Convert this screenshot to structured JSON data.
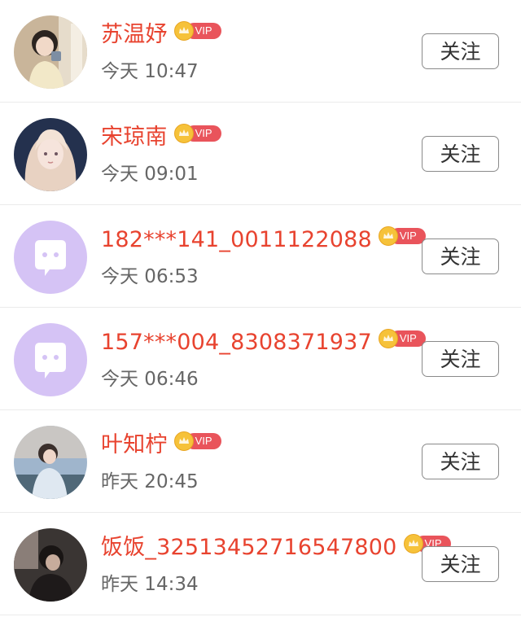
{
  "list": [
    {
      "name": "苏温妤",
      "badge": "VIP",
      "time": "今天 10:47",
      "follow_label": "关注",
      "avatar": "photo"
    },
    {
      "name": "宋琼南",
      "badge": "VIP",
      "time": "今天 09:01",
      "follow_label": "关注",
      "avatar": "photo"
    },
    {
      "name": "182***141_0011122088",
      "badge": "VIP",
      "time": "今天 06:53",
      "follow_label": "关注",
      "avatar": "default-chat-bubble"
    },
    {
      "name": "157***004_8308371937",
      "badge": "VIP",
      "time": "今天 06:46",
      "follow_label": "关注",
      "avatar": "default-chat-bubble"
    },
    {
      "name": "叶知柠",
      "badge": "VIP",
      "time": "昨天 20:45",
      "follow_label": "关注",
      "avatar": "photo"
    },
    {
      "name": "饭饭_32513452716547800",
      "badge": "VIP",
      "time": "昨天 14:34",
      "follow_label": "关注",
      "avatar": "photo"
    }
  ],
  "colors": {
    "name": "#e8432f",
    "vip_pill": "#e9545b",
    "crown": "#f6c23a",
    "default_avatar_bg": "#d5c3f5",
    "default_avatar_icon": "#ffffff"
  }
}
